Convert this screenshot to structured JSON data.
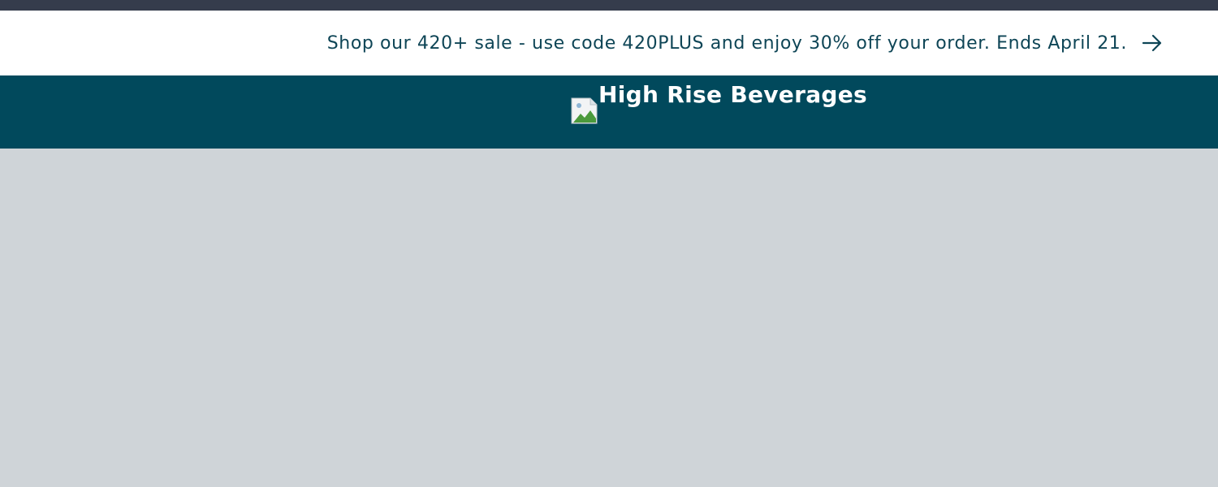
{
  "announcement": {
    "text": "Shop our 420+ sale - use code 420PLUS and enjoy 30% off your order. Ends April 21.",
    "icon": "arrow-right-icon"
  },
  "header": {
    "logo_alt": "High Rise Beverages",
    "logo_icon": "broken-image-icon"
  },
  "colors": {
    "top_strip": "#353c4c",
    "announcement_bg": "#ffffff",
    "announcement_text": "#0e4556",
    "header_bg": "#01495c",
    "page_bg": "#cfd4d8"
  }
}
